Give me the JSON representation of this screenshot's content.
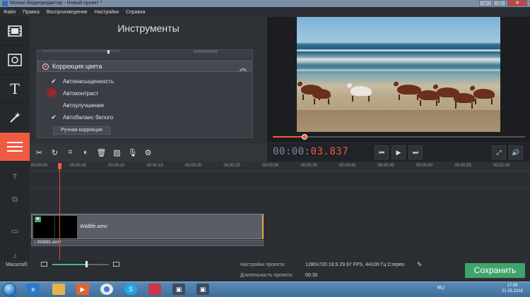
{
  "window": {
    "title": "Movavi Видеоредактор - Новый проект *"
  },
  "menu": [
    "Файл",
    "Правка",
    "Воспроизведение",
    "Настройки",
    "Справка"
  ],
  "leftnav": [
    {
      "name": "import-icon",
      "glyph": "🎞"
    },
    {
      "name": "filters-icon",
      "glyph": "▣"
    },
    {
      "name": "titles-icon",
      "glyph": "T"
    },
    {
      "name": "magic-wand-icon",
      "glyph": "✧"
    },
    {
      "name": "menu-icon",
      "glyph": "☰"
    }
  ],
  "tools": {
    "heading": "Инструменты",
    "section_title": "Коррекция цвета",
    "options": [
      {
        "label": "Автонасыщенность",
        "checked": true
      },
      {
        "label": "Автоконтраст",
        "checked": true
      },
      {
        "label": "Автоулучшение",
        "checked": false
      },
      {
        "label": "Автобаланс белого",
        "checked": true
      }
    ],
    "manual_button": "Ручная коррекция"
  },
  "player": {
    "timecode_dim": "00:00:",
    "timecode_hi": "03.837",
    "progress_fraction": 0.125
  },
  "timeline": {
    "ticks": [
      "00:00:00",
      "00:00:05",
      "00:00:10",
      "00:00:15",
      "00:00:20",
      "00:00:25",
      "00:00:30",
      "00:00:35",
      "00:00:40",
      "00:00:45",
      "00:00:50",
      "00:00:55",
      "00:01:00"
    ],
    "clip_name": "Wildlife.wmv",
    "audio_name": "Wildlife.wmv"
  },
  "status": {
    "zoom_label": "Масштаб:",
    "zoom_fraction": 0.6,
    "settings_label": "Настройки проекта:",
    "settings_value": "1280x720 16:9 29.97 FPS, 44100 Гц Стерео",
    "duration_label": "Длительность проекта:",
    "duration_value": "00:30",
    "save_button": "Сохранить"
  },
  "taskbar": {
    "lang": "RU",
    "time": "17:59",
    "date": "21.05.2016"
  },
  "colors": {
    "accent": "#f05a41",
    "save": "#3fa36b"
  }
}
